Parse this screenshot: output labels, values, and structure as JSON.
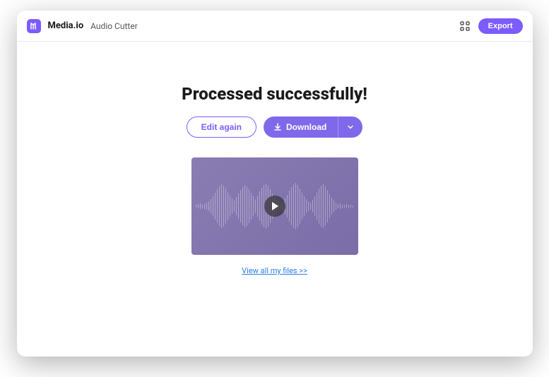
{
  "header": {
    "brand": "Media.io",
    "page": "Audio Cutter",
    "export_label": "Export"
  },
  "main": {
    "title": "Processed successfully!",
    "edit_again_label": "Edit again",
    "download_label": "Download",
    "view_files_label": "View all my files >>"
  },
  "colors": {
    "primary": "#7c5cff",
    "accent": "#8068ea",
    "link": "#2b7de9"
  }
}
